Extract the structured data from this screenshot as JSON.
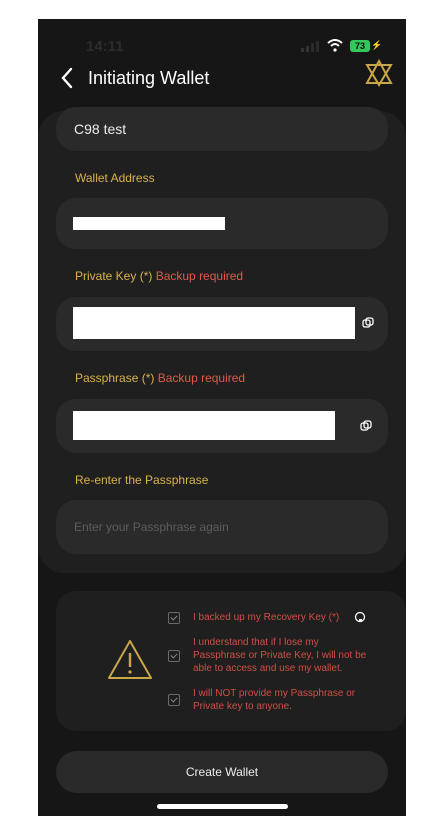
{
  "status": {
    "time": "14:11",
    "battery": "73"
  },
  "nav": {
    "title": "Initiating Wallet"
  },
  "form": {
    "wallet_name_value": "C98 test",
    "address_label": "Wallet Address",
    "private_key_label": "Private Key (*)",
    "private_key_note": "Backup required",
    "passphrase_label": "Passphrase (*)",
    "passphrase_note": "Backup required",
    "reenter_label": "Re-enter the Passphrase",
    "reenter_placeholder": "Enter your Passphrase again"
  },
  "confirmations": [
    {
      "text": "I backed up my Recovery Key (*)"
    },
    {
      "text": "I understand that if I lose my Passphrase or Private Key, I will not be able to access and use my wallet."
    },
    {
      "text": "I will NOT provide my Passphrase or Private key to anyone."
    }
  ],
  "actions": {
    "create_label": "Create Wallet"
  },
  "colors": {
    "accent_gold": "#d9b24a",
    "warning_red": "#e05a4a",
    "battery_green": "#34c759"
  },
  "icons": [
    "chevron-left-icon",
    "wallet-logo-icon",
    "copy-icon",
    "warning-triangle-icon",
    "checkbox-icon",
    "info-icon"
  ]
}
